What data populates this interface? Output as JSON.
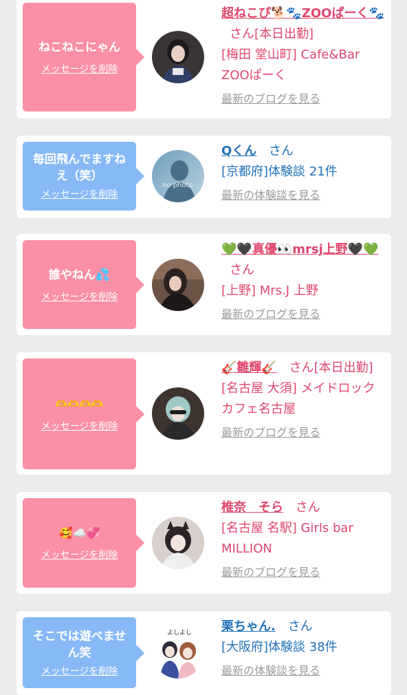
{
  "items": [
    {
      "message": "ねこねこにゃん",
      "delete_label": "メッセージを削除",
      "name": "超ねこぴ🐕🐾ZOOぱーく🐾",
      "honorific": "さん",
      "status": "[本日出勤]",
      "location": "[梅田 堂山町] Cafe&Bar ZOOぱーく",
      "link": "最新のブログを見る",
      "color": "pink"
    },
    {
      "message": "毎回飛んでますねえ（笑）",
      "delete_label": "メッセージを削除",
      "name": "Qくん",
      "honorific": "さん",
      "location": "[京都府]体験談 21件",
      "link": "最新の体験談を見る",
      "avatar_text": "no photo",
      "color": "blue"
    },
    {
      "message": "誰やねん💦",
      "delete_label": "メッセージを削除",
      "name": "💚🖤真優👀mrsj上野🖤💚",
      "honorific": "さん",
      "location": "[上野] Mrs.J 上野",
      "link": "最新のブログを見る",
      "color": "pink"
    },
    {
      "message": "🫶🫶🫶🫶",
      "delete_label": "メッセージを削除",
      "name": "🎸雛輝🎸",
      "honorific": "さん",
      "status": "[本日出勤]",
      "location": "[名古屋 大須] メイドロックカフェ名古屋",
      "link": "最新のブログを見る",
      "color": "pink"
    },
    {
      "message": "🥰☁️💞",
      "delete_label": "メッセージを削除",
      "name": "椎奈　そら",
      "honorific": "さん",
      "location": "[名古屋 名駅] Girls bar MILLION",
      "link": "最新のブログを見る",
      "color": "pink"
    },
    {
      "message": "そこでは遊べません笑",
      "delete_label": "メッセージを削除",
      "name": "栗ちゃん.",
      "honorific": "さん",
      "location": "[大阪府]体験談 38件",
      "link": "最新の体験談を見る",
      "avatar_text": "よしよし",
      "color": "blue"
    }
  ]
}
